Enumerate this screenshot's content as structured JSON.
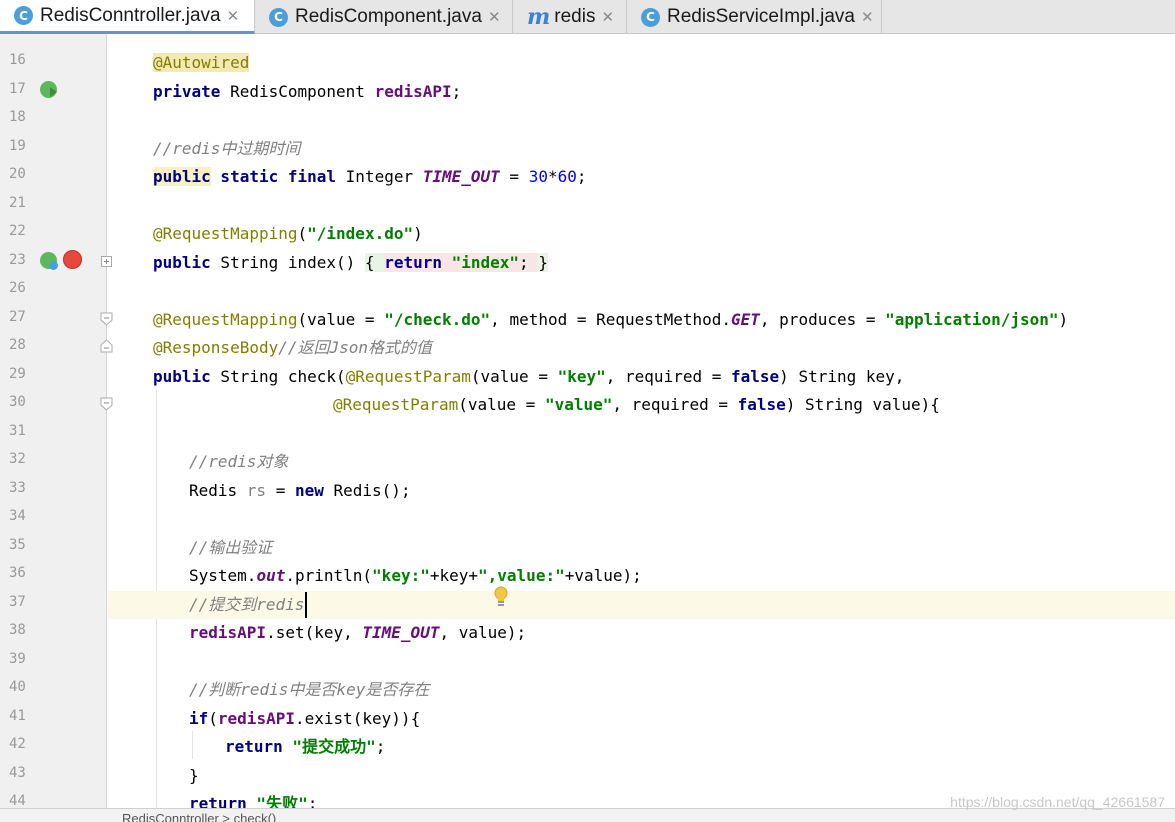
{
  "tabs": [
    {
      "icon": "class-icon",
      "label": "RedisConntroller.java",
      "active": true
    },
    {
      "icon": "class-icon",
      "label": "RedisComponent.java",
      "active": false
    },
    {
      "icon": "module-icon",
      "label": "redis",
      "active": false
    },
    {
      "icon": "class-icon",
      "label": "RedisServiceImpl.java",
      "active": false
    }
  ],
  "gutter": {
    "line_numbers": [
      "16",
      "17",
      "18",
      "19",
      "20",
      "21",
      "22",
      "23",
      "26",
      "27",
      "28",
      "29",
      "30",
      "31",
      "32",
      "33",
      "34",
      "35",
      "36",
      "37",
      "38",
      "39",
      "40",
      "41",
      "42",
      "43",
      "44"
    ]
  },
  "code": {
    "l16": {
      "annotation": "@Autowired"
    },
    "l17": {
      "kw": "private",
      "type": " RedisComponent ",
      "field": "redisAPI",
      "tail": ";"
    },
    "l19": {
      "comment": "//redis中过期时间"
    },
    "l20": {
      "kw1": "public",
      "kw2": " static final",
      "type": " Integer ",
      "sfield": "TIME_OUT",
      "op": " = ",
      "n1": "30",
      "mul": "*",
      "n2": "60",
      "tail": ";"
    },
    "l22": {
      "annotation": "@RequestMapping",
      "open": "(",
      "str": "\"/index.do\"",
      "close": ")"
    },
    "l23": {
      "kw": "public",
      "sig": " String index() ",
      "brace_open": "{ ",
      "ret": "return",
      "str": " \"index\"",
      "semi": "; ",
      "brace_close": "}"
    },
    "l27": {
      "annotation": "@RequestMapping",
      "p1": "(value = ",
      "s1": "\"/check.do\"",
      "p2": ", method = RequestMethod.",
      "get": "GET",
      "p3": ", produces = ",
      "s2": "\"application/json\"",
      "p4": ")"
    },
    "l28": {
      "annotation": "@ResponseBody",
      "comment": "//返回Json格式的值"
    },
    "l29": {
      "kw": "public",
      "p1": " String check(",
      "ann": "@RequestParam",
      "p2": "(value = ",
      "s1": "\"key\"",
      "p3": ", required = ",
      "f1": "false",
      "p4": ") String key,"
    },
    "l30": {
      "ann": "@RequestParam",
      "p1": "(value = ",
      "s1": "\"value\"",
      "p2": ", required = ",
      "f1": "false",
      "p3": ") String value){"
    },
    "l32": {
      "comment": "//redis对象"
    },
    "l33": {
      "p1": "Redis ",
      "var": "rs",
      "p2": " = ",
      "kw": "new",
      "p3": " Redis();"
    },
    "l35": {
      "comment": "//输出验证"
    },
    "l36": {
      "p1": "System.",
      "out": "out",
      "p2": ".println(",
      "s1": "\"key:\"",
      "p3": "+key+",
      "s2": "\",value:\"",
      "p4": "+value);"
    },
    "l37": {
      "comment": "//提交到redis"
    },
    "l38": {
      "field": "redisAPI",
      "p1": ".set(key, ",
      "sfield": "TIME_OUT",
      "p2": ", value);"
    },
    "l40": {
      "comment": "//判断redis中是否key是否存在"
    },
    "l41": {
      "kw": "if",
      "p1": "(",
      "field": "redisAPI",
      "p2": ".exist(key)){"
    },
    "l42": {
      "kw": "return",
      "str": " \"提交成功\"",
      "tail": ";"
    },
    "l43": {
      "p1": "}"
    },
    "l44": {
      "kw": "return",
      "str": " \"失败\"",
      "tail": ";"
    }
  },
  "breadcrumb": "RedisConntroller > check()",
  "watermark": "https://blog.csdn.net/qq_42661587",
  "colors": {
    "keyword": "#000080",
    "string": "#008000",
    "comment": "#808080",
    "annotation": "#808000",
    "field": "#660e7a",
    "number": "#0000ff"
  }
}
